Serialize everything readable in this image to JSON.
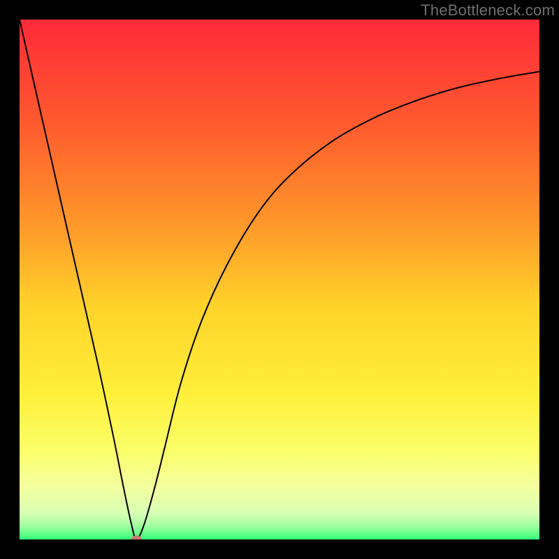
{
  "watermark": "TheBottleneck.com",
  "chart_data": {
    "type": "line",
    "title": "",
    "xlabel": "",
    "ylabel": "",
    "xlim": [
      0,
      100
    ],
    "ylim": [
      0,
      100
    ],
    "gradient_stops": [
      {
        "offset": 0.0,
        "color": "#ff2a3a"
      },
      {
        "offset": 0.2,
        "color": "#ff5a2e"
      },
      {
        "offset": 0.4,
        "color": "#ff9a2a"
      },
      {
        "offset": 0.55,
        "color": "#ffd22a"
      },
      {
        "offset": 0.72,
        "color": "#ffef3a"
      },
      {
        "offset": 0.83,
        "color": "#fbff6a"
      },
      {
        "offset": 0.9,
        "color": "#f4ffa0"
      },
      {
        "offset": 0.95,
        "color": "#d8ffb4"
      },
      {
        "offset": 0.975,
        "color": "#9effa0"
      },
      {
        "offset": 1.0,
        "color": "#34ff77"
      }
    ],
    "series": [
      {
        "name": "curve",
        "points": [
          {
            "x": 0.0,
            "y": 100.0
          },
          {
            "x": 5.0,
            "y": 78.0
          },
          {
            "x": 10.0,
            "y": 56.0
          },
          {
            "x": 15.0,
            "y": 34.0
          },
          {
            "x": 18.0,
            "y": 20.0
          },
          {
            "x": 20.0,
            "y": 10.0
          },
          {
            "x": 21.5,
            "y": 3.0
          },
          {
            "x": 22.5,
            "y": 0.0
          },
          {
            "x": 24.0,
            "y": 3.0
          },
          {
            "x": 26.0,
            "y": 10.0
          },
          {
            "x": 28.0,
            "y": 18.0
          },
          {
            "x": 31.0,
            "y": 30.0
          },
          {
            "x": 35.0,
            "y": 42.0
          },
          {
            "x": 40.0,
            "y": 53.0
          },
          {
            "x": 46.0,
            "y": 63.0
          },
          {
            "x": 52.0,
            "y": 70.0
          },
          {
            "x": 60.0,
            "y": 76.5
          },
          {
            "x": 68.0,
            "y": 81.0
          },
          {
            "x": 76.0,
            "y": 84.3
          },
          {
            "x": 84.0,
            "y": 86.8
          },
          {
            "x": 92.0,
            "y": 88.6
          },
          {
            "x": 100.0,
            "y": 90.0
          }
        ]
      }
    ],
    "marker": {
      "x": 22.5,
      "y": 0.0,
      "rx": 8,
      "ry": 5.5,
      "color": "#c97a70"
    }
  }
}
